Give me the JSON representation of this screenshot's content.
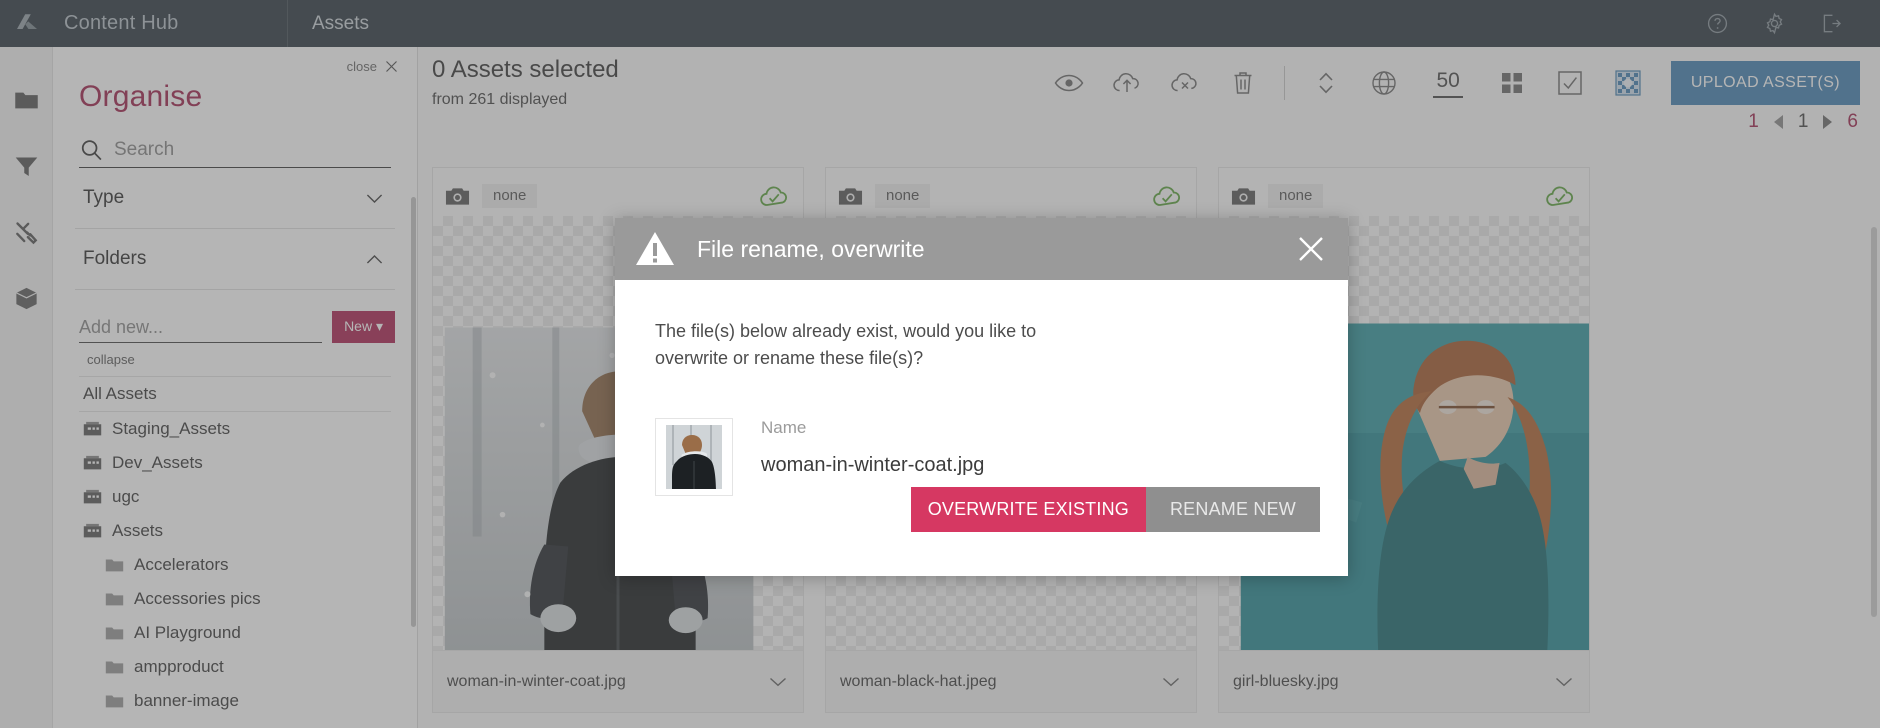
{
  "topbar": {
    "logo_icon": "drive-triangle-logo",
    "brand": "Content Hub",
    "section": "Assets",
    "icons": [
      {
        "name": "help-icon",
        "label": "Help"
      },
      {
        "name": "gear-icon",
        "label": "Settings"
      },
      {
        "name": "logout-icon",
        "label": "Log out"
      }
    ]
  },
  "rail": {
    "items": [
      {
        "name": "rail-item-folders",
        "icon": "folder-icon"
      },
      {
        "name": "rail-item-filter",
        "icon": "funnel-icon"
      },
      {
        "name": "rail-item-tools",
        "icon": "tools-icon"
      },
      {
        "name": "rail-item-assets",
        "icon": "cube-icon"
      }
    ]
  },
  "organise": {
    "close_label": "close",
    "title": "Organise",
    "search_placeholder": "Search",
    "search_value": "",
    "sections": [
      {
        "label": "Type",
        "expanded": false
      },
      {
        "label": "Folders",
        "expanded": true
      }
    ],
    "add_new_placeholder": "Add new...",
    "add_new_value": "",
    "new_button": "New ▾",
    "collapse_label": "collapse",
    "all_assets_label": "All Assets",
    "folders": [
      {
        "label": "Staging_Assets",
        "level": 1,
        "icon": "archive-folder-icon"
      },
      {
        "label": "Dev_Assets",
        "level": 1,
        "icon": "archive-folder-icon"
      },
      {
        "label": "ugc",
        "level": 1,
        "icon": "archive-folder-icon"
      },
      {
        "label": "Assets",
        "level": 1,
        "icon": "archive-folder-icon"
      },
      {
        "label": "Accelerators",
        "level": 2,
        "icon": "folder-icon"
      },
      {
        "label": "Accessories pics",
        "level": 2,
        "icon": "folder-icon"
      },
      {
        "label": "AI Playground",
        "level": 2,
        "icon": "folder-icon"
      },
      {
        "label": "ampproduct",
        "level": 2,
        "icon": "folder-icon"
      },
      {
        "label": "banner-image",
        "level": 2,
        "icon": "folder-icon"
      }
    ]
  },
  "main": {
    "selected_title": "0 Assets selected",
    "selected_subtitle": "from 261 displayed",
    "toolbar": {
      "icons": [
        {
          "name": "preview-eye-icon",
          "label": "Preview"
        },
        {
          "name": "cloud-upload-icon",
          "label": "Publish"
        },
        {
          "name": "cloud-unpublish-icon",
          "label": "Unpublish"
        },
        {
          "name": "trash-icon",
          "label": "Delete"
        },
        {
          "name": "sort-icon",
          "label": "Sort"
        },
        {
          "name": "globe-icon",
          "label": "Locales"
        }
      ],
      "page_size": "50",
      "view_icons": [
        {
          "name": "grid-view-icon",
          "label": "Grid view"
        },
        {
          "name": "select-all-icon",
          "label": "Select all"
        },
        {
          "name": "transparency-view-icon",
          "label": "Transparency"
        }
      ],
      "upload_label": "UPLOAD ASSET(S)"
    },
    "pagination": {
      "first": "1",
      "prev_icon": "chevron-left-icon",
      "current": "1",
      "next_icon": "chevron-right-icon",
      "last": "6"
    },
    "cards": [
      {
        "camera_icon": "camera-icon",
        "badge": "none",
        "status_icon": "cloud-check-icon",
        "filename": "woman-in-winter-coat.jpg",
        "expand_icon": "chevron-down-icon"
      },
      {
        "camera_icon": "camera-icon",
        "badge": "none",
        "status_icon": "cloud-check-icon",
        "filename": "woman-black-hat.jpeg",
        "expand_icon": "chevron-down-icon"
      },
      {
        "camera_icon": "camera-icon",
        "badge": "none",
        "status_icon": "cloud-check-icon",
        "filename": "girl-bluesky.jpg",
        "expand_icon": "chevron-down-icon"
      }
    ]
  },
  "modal": {
    "warning_icon": "warning-triangle-icon",
    "title": "File rename, overwrite",
    "close_icon": "close-icon",
    "message": "The file(s) below already exist, would you like to overwrite or rename these file(s)?",
    "file": {
      "thumb_icon": "file-thumbnail",
      "name_label": "Name",
      "name_value": "woman-in-winter-coat.jpg"
    },
    "overwrite_label": "OVERWRITE EXISTING",
    "rename_label": "RENAME NEW"
  },
  "colors": {
    "topbar_bg": "#333f48",
    "accent_crimson": "#a32a52",
    "accent_pink": "#d63862",
    "upload_blue": "#4a86b4",
    "status_green": "#62a744"
  }
}
